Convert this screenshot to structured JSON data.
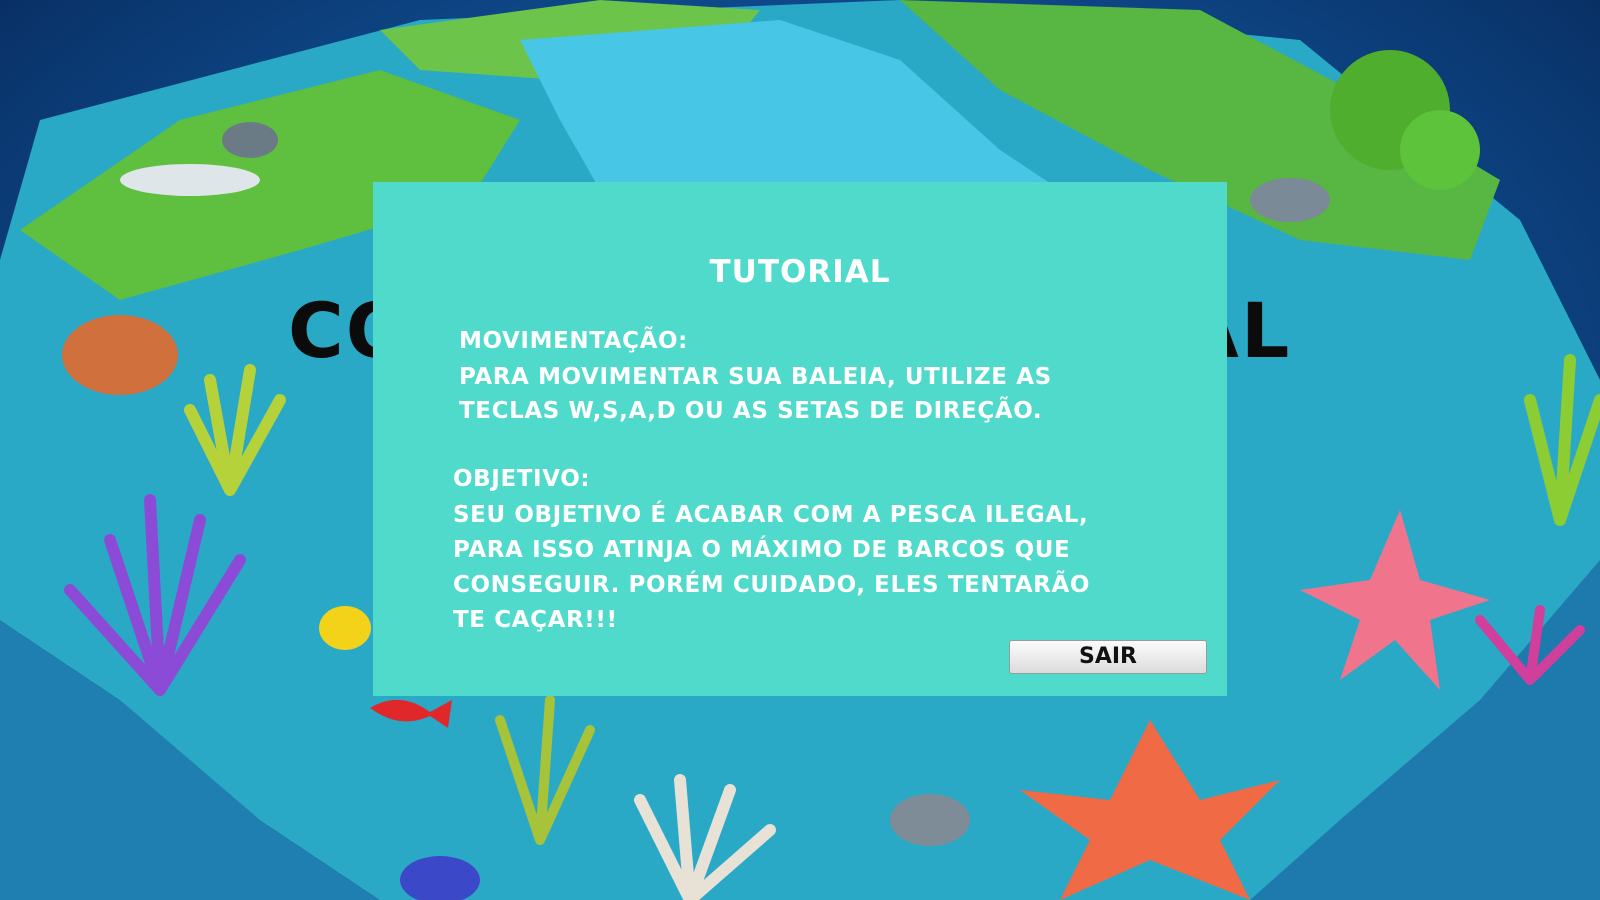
{
  "background_title": {
    "left": "CO",
    "right": "AL"
  },
  "tutorial": {
    "heading": "TUTORIAL",
    "movement_title": "MOVIMENTAÇÃO:",
    "movement_lines": [
      "PARA MOVIMENTAR SUA BALEIA, UTILIZE AS",
      "TECLAS W,S,A,D OU AS SETAS DE DIREÇÃO."
    ],
    "objective_title": "OBJETIVO:",
    "objective_lines": [
      "SEU OBJETIVO É ACABAR COM A PESCA ILEGAL,",
      "PARA ISSO ATINJA O MÁXIMO DE BARCOS QUE",
      "CONSEGUIR. PORÉM CUIDADO, ELES TENTARÃO",
      "TE CAÇAR!!!"
    ],
    "exit_label": "SAIR"
  },
  "colors": {
    "panel": "#4fdacc",
    "ocean": "#0f4a8c",
    "text": "#ffffff"
  }
}
